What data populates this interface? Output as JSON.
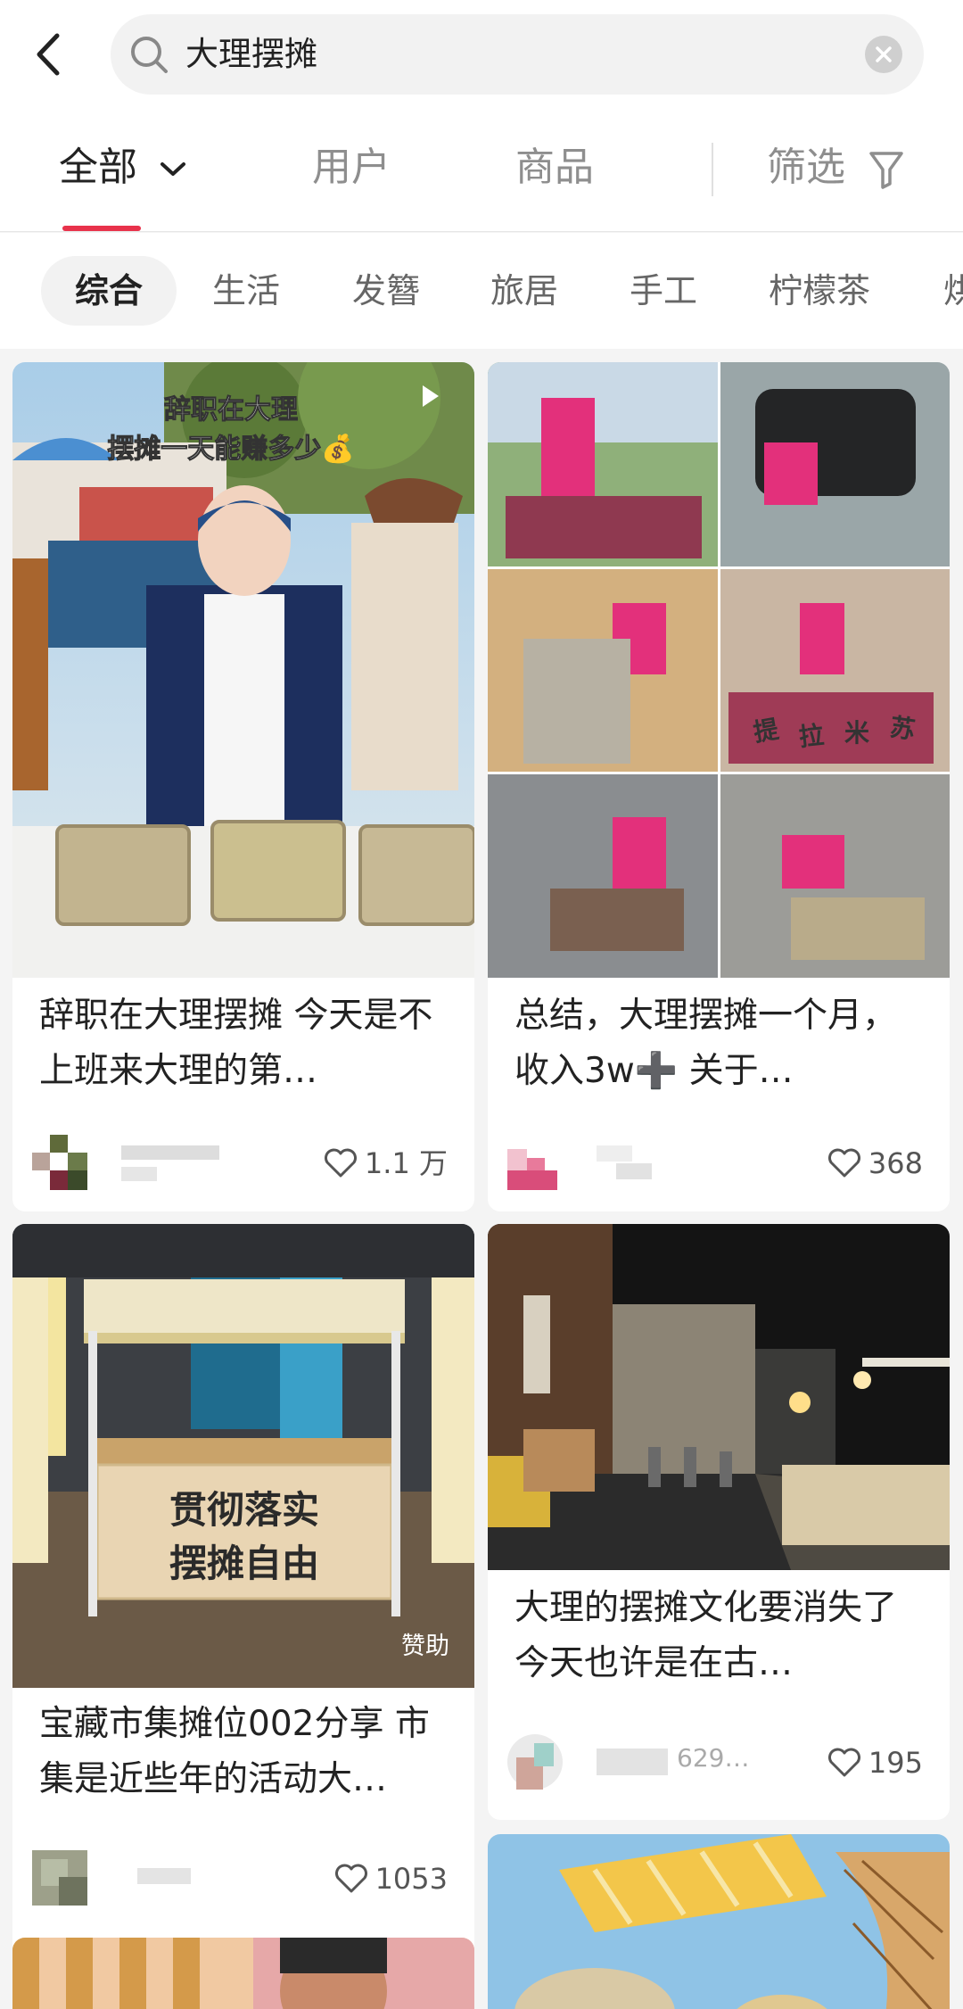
{
  "search": {
    "query": "大理摆摊"
  },
  "tabs": {
    "all": "全部",
    "user": "用户",
    "goods": "商品",
    "filter": "筛选"
  },
  "chips": [
    "综合",
    "生活",
    "发簪",
    "旅居",
    "手工",
    "柠檬茶",
    "烘"
  ],
  "cards": [
    {
      "image_caption_line1": "辞职在大理",
      "image_caption_line2": "摆摊一天能赚多少💰",
      "title": "辞职在大理摆摊 今天是不上班来大理的第…",
      "likes": "1.1 万"
    },
    {
      "image_banner_chars": [
        "提",
        "拉",
        "米",
        "苏"
      ],
      "title": "总结，大理摆摊一个月，收入3w➕ 关于…",
      "likes": "368"
    },
    {
      "image_sign_line1": "贯彻落实",
      "image_sign_line2": "摆摊自由",
      "sponsor": "赞助",
      "title": "宝藏市集摊位002分享 市集是近些年的活动大…",
      "likes": "1053"
    },
    {
      "title": "大理的摆摊文化要消失了 今天也许是在古…",
      "author_partial": "629…",
      "likes": "195"
    }
  ],
  "colors": {
    "accent": "#e8324b",
    "background": "#f4f4f4"
  }
}
